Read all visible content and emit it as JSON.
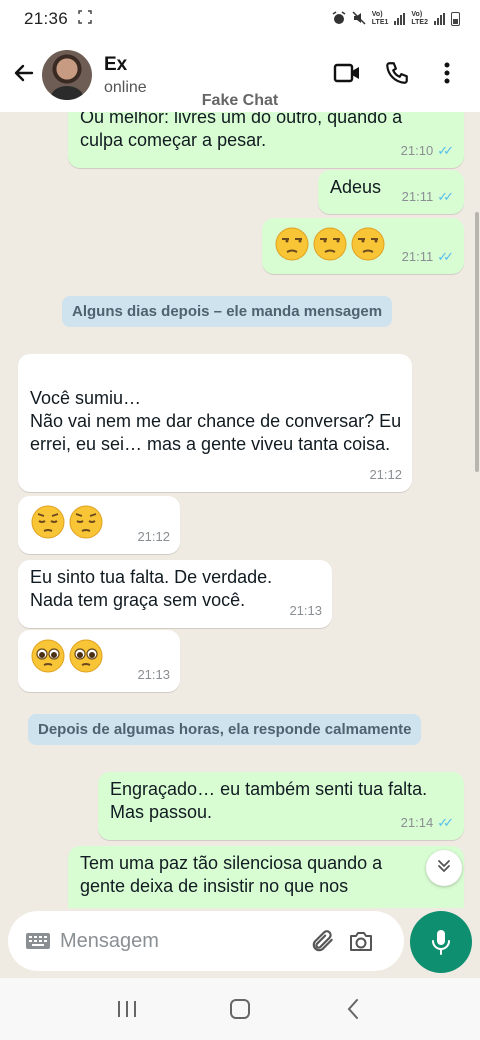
{
  "status_bar": {
    "time": "21:36"
  },
  "header": {
    "contact_name": "Ex",
    "contact_status": "online"
  },
  "watermark": "Fake Chat",
  "messages": [
    {
      "dir": "out",
      "text": "Ou melhor: livres um do outro, quando a culpa começar a pesar.",
      "time": "21:10"
    },
    {
      "dir": "out",
      "text": "Adeus",
      "time": "21:11"
    },
    {
      "dir": "out",
      "text": "😒😒😒",
      "time": "21:11"
    },
    {
      "dir": "system",
      "text": "Alguns dias depois – ele manda mensagem"
    },
    {
      "dir": "in",
      "text": "Você sumiu…\nNão vai nem me dar chance de conversar? Eu errei, eu sei… mas a gente viveu tanta coisa.",
      "time": "21:12"
    },
    {
      "dir": "in",
      "text": "😔😔",
      "time": "21:12"
    },
    {
      "dir": "in",
      "text": "Eu sinto tua falta. De verdade. Nada tem graça sem você.",
      "time": "21:13"
    },
    {
      "dir": "in",
      "text": "🥺🥺",
      "time": "21:13"
    },
    {
      "dir": "system",
      "text": "Depois de algumas horas, ela responde calmamente"
    },
    {
      "dir": "out",
      "text": "Engraçado… eu também senti tua falta. Mas passou.",
      "time": "21:14"
    },
    {
      "dir": "out",
      "text": "Tem uma paz tão silenciosa quando a gente deixa de insistir no que nos",
      "time": ""
    }
  ],
  "input": {
    "placeholder": "Mensagem"
  },
  "colors": {
    "outgoing_bubble": "#d9fdd3",
    "incoming_bubble": "#ffffff",
    "chat_background": "#efeae2",
    "read_ticks": "#53bdeb",
    "mic_button": "#0e8f6f",
    "system_message_bg": "#cfe3ef"
  },
  "icons": [
    "arrow-back-icon",
    "video-call-icon",
    "phone-icon",
    "more-vert-icon",
    "keyboard-icon",
    "attach-icon",
    "camera-icon",
    "mic-icon",
    "double-chevron-down-icon",
    "recents-icon",
    "home-icon",
    "back-nav-icon"
  ]
}
